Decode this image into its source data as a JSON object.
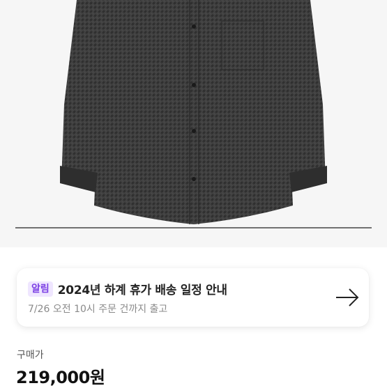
{
  "product": {
    "image_alt": "Dark gray checked long-sleeve button-up shirt with chest pocket"
  },
  "notice": {
    "badge": "알림",
    "title": "2024년 하계 휴가 배송 일정 안내",
    "subtitle": "7/26 오전 10시 주문 건까지 출고",
    "arrow_icon": "arrow-right-icon"
  },
  "price": {
    "label": "구매가",
    "value": "219,000원"
  }
}
